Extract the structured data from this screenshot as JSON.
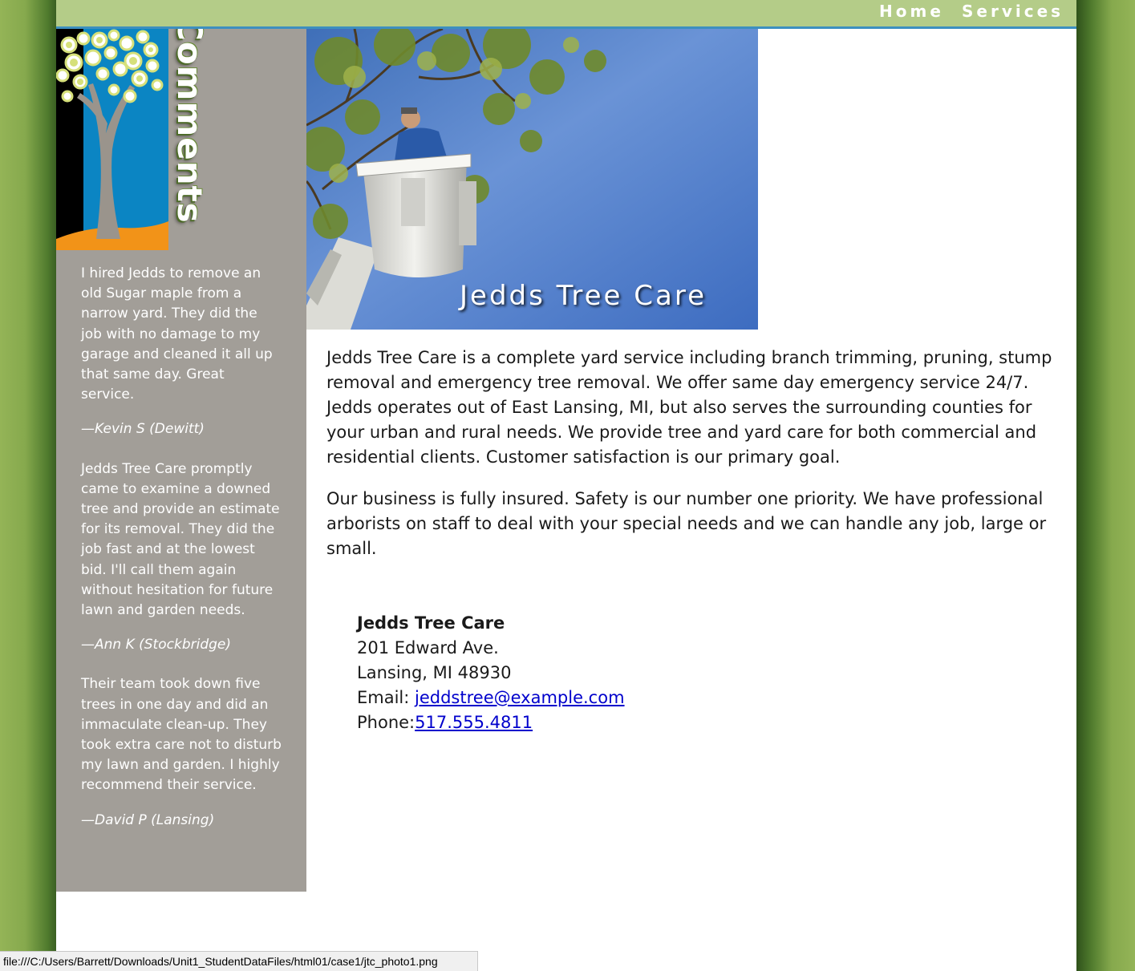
{
  "nav": {
    "home_label": "Home",
    "services_label": "Services"
  },
  "sidebar": {
    "title": "Comments",
    "testimonials": [
      {
        "quote": "I hired Jedds to remove an old Sugar maple from a narrow yard. They did the job with no damage to my garage and cleaned it all up that same day. Great service.",
        "author": "—Kevin S (Dewitt)"
      },
      {
        "quote": "Jedds Tree Care promptly came to examine a downed tree and provide an estimate for its removal. They did the job fast and at the lowest bid. I'll call them again without hesitation for future lawn and garden needs.",
        "author": "—Ann K (Stockbridge)"
      },
      {
        "quote": "Their team took down five trees in one day and did an immaculate clean-up. They took extra care not to disturb my lawn and garden. I highly recommend their service.",
        "author": "—David P (Lansing)"
      }
    ]
  },
  "hero": {
    "caption": "Jedds Tree Care"
  },
  "main": {
    "paragraphs": [
      "Jedds Tree Care is a complete yard service including branch trimming, pruning, stump removal and emergency tree removal. We offer same day emergency service 24/7. Jedds operates out of East Lansing, MI, but also serves the surrounding counties for your urban and rural needs. We provide tree and yard care for both commercial and residential clients. Customer satisfaction is our primary goal.",
      "Our business is fully insured. Safety is our number one priority. We have professional arborists on staff to deal with your special needs and we can handle any job, large or small."
    ]
  },
  "address": {
    "name": "Jedds Tree Care",
    "street": "201 Edward Ave.",
    "city": "Lansing, MI 48930",
    "email_label": "Email: ",
    "email": "jeddstree@example.com",
    "phone_label": "Phone:",
    "phone": "517.555.4811"
  },
  "statusbar": {
    "url": "file:///C:/Users/Barrett/Downloads/Unit1_StudentDataFiles/html01/case1/jtc_photo1.png"
  },
  "colors": {
    "nav_bg": "#b4cc88",
    "nav_border": "#3d8fbf",
    "sidebar_bg": "#a29e98",
    "page_bg": "#8aae52",
    "link": "#0000cc"
  }
}
